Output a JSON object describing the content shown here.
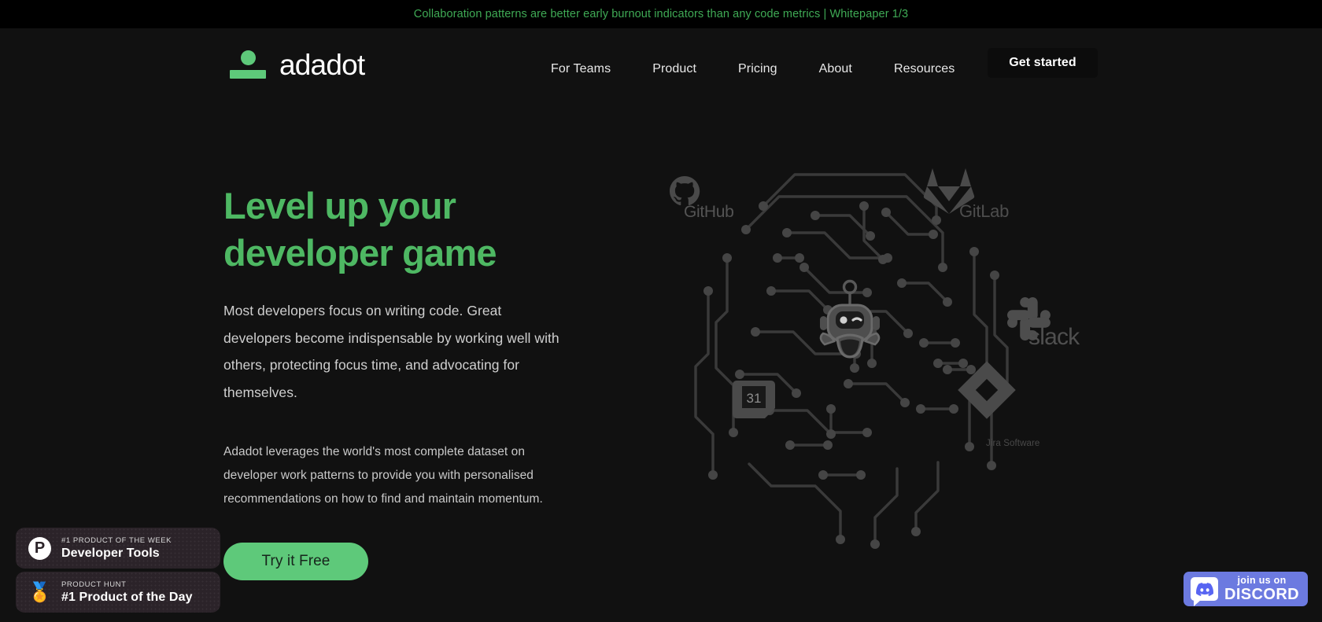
{
  "announcement": {
    "text": "Collaboration patterns are better early burnout indicators than any code metrics | Whitepaper 1/3",
    "color": "#3faa55"
  },
  "header": {
    "logo_text": "adadot",
    "logo_icon": "adadot-dot-bar-logo",
    "nav_items": [
      {
        "label": "For Teams"
      },
      {
        "label": "Product"
      },
      {
        "label": "Pricing"
      },
      {
        "label": "About"
      },
      {
        "label": "Resources"
      }
    ],
    "cta_label": "Get started"
  },
  "hero": {
    "title_line1": "Level up your",
    "title_line2": "developer game",
    "title_color": "#4eb863",
    "subtitle": "Most developers focus on writing code. Great developers become indispensable by working well with others, protecting focus time, and advocating for themselves.",
    "description": "Adadot leverages the world's most complete dataset on developer work patterns to provide you with personalised recommendations on how to find and maintain momentum.",
    "cta_label": "Try it Free",
    "cta_color": "#5ec97a"
  },
  "illustration": {
    "alt": "circuit-board brain with robot face",
    "calendar_day": "31",
    "brands": [
      {
        "name": "GitHub",
        "label": "GitHub"
      },
      {
        "name": "GitLab",
        "label": "GitLab"
      },
      {
        "name": "Slack",
        "label": "slack"
      },
      {
        "name": "Jira",
        "label": "Jira Software"
      }
    ]
  },
  "badges": [
    {
      "icon": "product-hunt-p-icon",
      "kicker": "#1 PRODUCT OF THE WEEK",
      "title": "Developer Tools"
    },
    {
      "icon": "gold-medal-icon",
      "kicker": "PRODUCT HUNT",
      "title": "#1 Product of the Day"
    }
  ],
  "discord": {
    "small_text": "join us on",
    "big_text": "DISCORD",
    "color": "#6c7ae0"
  }
}
